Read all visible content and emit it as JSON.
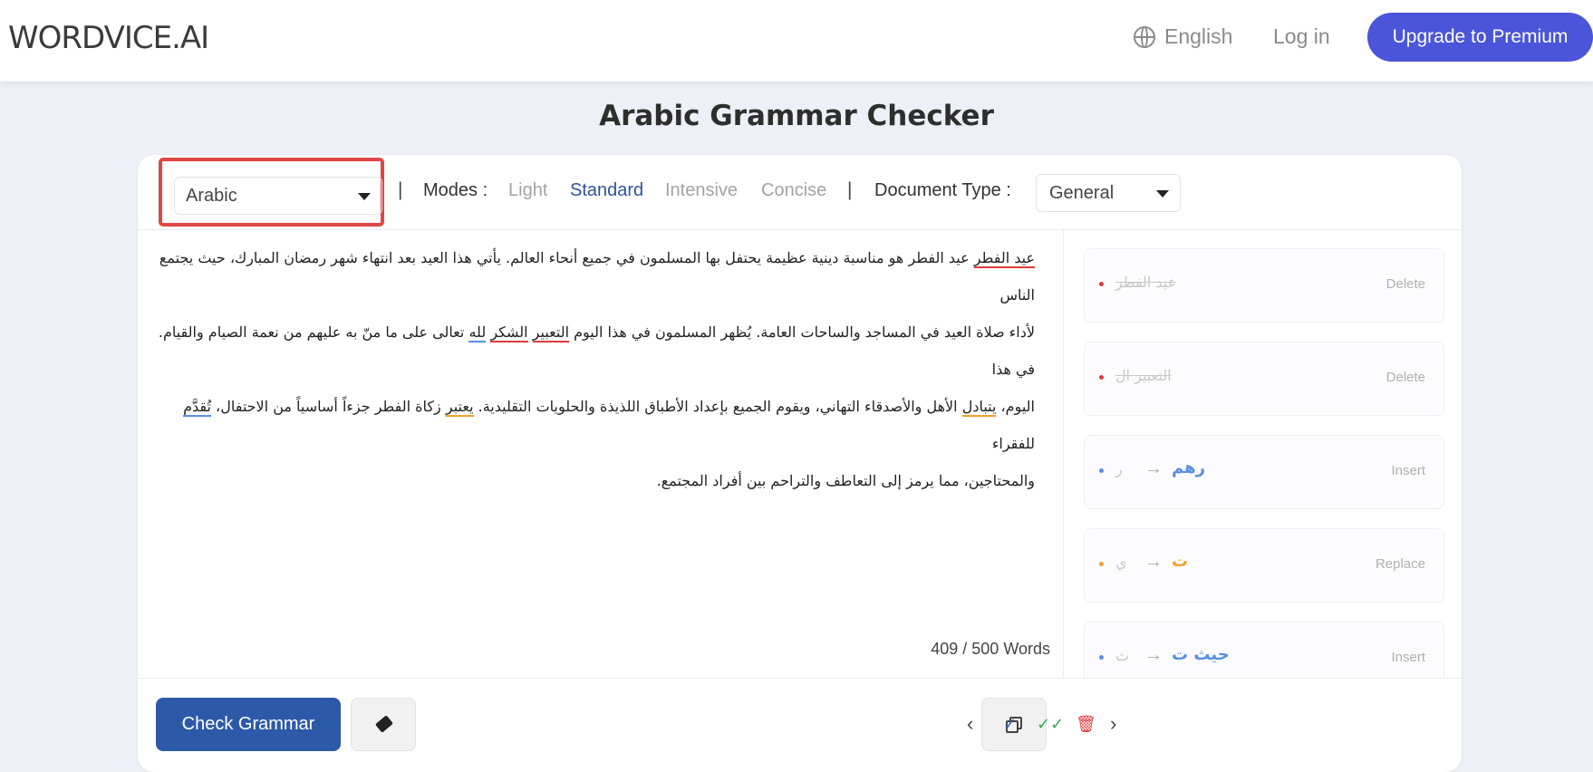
{
  "header": {
    "logo": "WORDVICE.AI",
    "language": "English",
    "login": "Log in",
    "upgrade": "Upgrade to Premium"
  },
  "page_title": "Arabic Grammar Checker",
  "toolbar": {
    "language_value": "Arabic",
    "modes_label": "Modes :",
    "modes": [
      "Light",
      "Standard",
      "Intensive",
      "Concise"
    ],
    "active_mode": "Standard",
    "document_type_label": "Document Type :",
    "document_type_value": "General",
    "separator": "|"
  },
  "editor": {
    "lines": [
      [
        {
          "t": "عيد الفطر",
          "e": "red"
        },
        {
          "t": " عيد الفطر هو مناسبة دينية عظيمة يحتفل بها المسلمون في جميع أنحاء العالم. يأتي هذا العيد بعد انتهاء شهر رمضان المبارك، حيث يجتمع الناس"
        }
      ],
      [
        {
          "t": "لأداء صلاة العيد في المساجد والساحات العامة. يُظهر المسلمون في هذا اليوم "
        },
        {
          "t": "التعبير",
          "e": "red"
        },
        {
          "t": " "
        },
        {
          "t": "الشكر",
          "e": "red"
        },
        {
          "t": " "
        },
        {
          "t": "لله",
          "e": "blue"
        },
        {
          "t": " تعالى على ما منّ به عليهم من نعمة الصيام والقيام. في هذا"
        }
      ],
      [
        {
          "t": "اليوم، "
        },
        {
          "t": "يتبادل",
          "e": "orange"
        },
        {
          "t": " الأهل والأصدقاء التهاني، ويقوم الجميع بإعداد الأطباق اللذيذة والحلويات التقليدية. "
        },
        {
          "t": "يعتبر",
          "e": "orange"
        },
        {
          "t": " زكاة الفطر جزءاً أساسياً من الاحتفال، "
        },
        {
          "t": "تُقدَّم",
          "e": "blue"
        },
        {
          "t": " للفقراء"
        }
      ],
      [
        {
          "t": "والمحتاجين، مما يرمز إلى التعاطف والتراحم بين أفراد المجتمع."
        }
      ]
    ],
    "word_count": "409 / 500 Words"
  },
  "suggestions": [
    {
      "original": "عيد الفطر",
      "replacement": "",
      "action": "Delete",
      "type": "delete",
      "color": "#e03b3b"
    },
    {
      "original": "التعبير ال",
      "replacement": "",
      "action": "Delete",
      "type": "delete",
      "color": "#e03b3b"
    },
    {
      "original": "ر",
      "replacement": "رهم",
      "action": "Insert",
      "type": "insert",
      "color": "#5a8ee0"
    },
    {
      "original": "ي",
      "replacement": "ت",
      "action": "Replace",
      "type": "replace",
      "color": "#f0a030"
    },
    {
      "original": "ث",
      "replacement": "حيث ت",
      "action": "Insert",
      "type": "insert",
      "color": "#5a8ee0"
    }
  ],
  "bottom": {
    "check_grammar": "Check Grammar"
  },
  "icons": {
    "eraser": "eraser-icon",
    "copy": "copy-icon",
    "prev": "chevron-left-icon",
    "accept": "check-icon",
    "accept_all": "double-check-icon",
    "delete": "trash-icon",
    "next": "chevron-right-icon"
  },
  "colors": {
    "brand": "#4a55d9",
    "primary": "#2d5aa8",
    "active_mode": "#2d5599",
    "highlight_border": "#e04646",
    "error_red": "#e03b3b",
    "error_blue": "#5a8ee0",
    "error_orange": "#f0a030"
  }
}
